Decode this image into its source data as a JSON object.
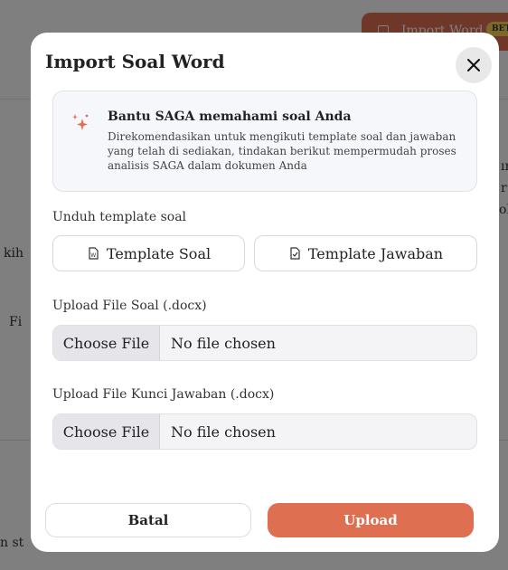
{
  "background": {
    "import_button_label": "Import Word",
    "beta_badge": "BETA",
    "fragment_kih": "kih",
    "fragment_fi": "Fi",
    "fragment_st": "n st",
    "fragment_r1": "ır",
    "fragment_r2": "r",
    "fragment_r3": "ol"
  },
  "modal": {
    "title": "Import Soal Word",
    "close_glyph": "✕",
    "info": {
      "title": "Bantu SAGA memahami soal Anda",
      "body": "Direkomendasikan untuk mengikuti template soal dan jawaban yang telah di sediakan, tindakan berikut mempermudah proses analisis SAGA dalam dokumen Anda"
    },
    "template_section": {
      "label": "Unduh template soal",
      "soal_button": "Template Soal",
      "jawaban_button": "Template Jawaban"
    },
    "upload_soal": {
      "label": "Upload File Soal (.docx)",
      "choose_label": "Choose File",
      "status": "No file chosen"
    },
    "upload_kunci": {
      "label": "Upload File Kunci Jawaban (.docx)",
      "choose_label": "Choose File",
      "status": "No file chosen"
    },
    "footer": {
      "cancel_label": "Batal",
      "upload_label": "Upload"
    }
  },
  "colors": {
    "accent": "#df6f51",
    "beta": "#f5d35a",
    "overlay": "rgba(0,0,0,0.5)"
  },
  "icons": {
    "sparkle": "sparkle-icon",
    "word_doc": "word-doc-icon",
    "check_doc": "check-doc-icon",
    "close": "close-icon",
    "import": "import-icon"
  }
}
